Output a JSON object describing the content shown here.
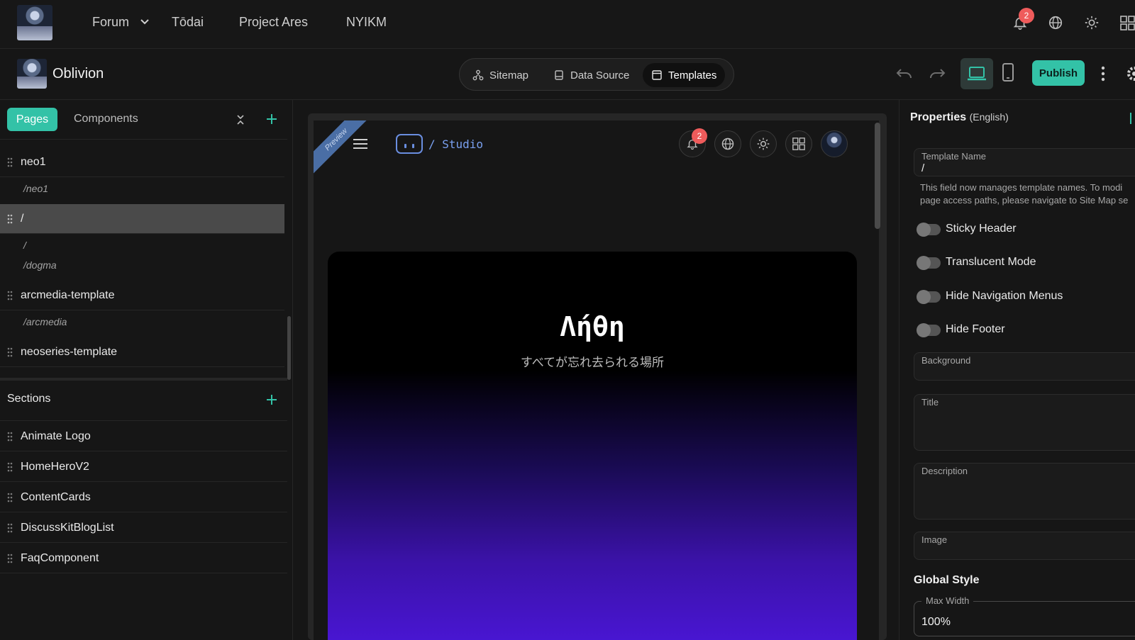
{
  "topnav": {
    "links": [
      "Forum",
      "Tōdai",
      "Project Ares",
      "NYIKM"
    ],
    "notification_count": "2"
  },
  "toolbar": {
    "site_name": "Oblivion",
    "tabs": [
      {
        "label": "Sitemap",
        "icon": "sitemap-icon"
      },
      {
        "label": "Data Source",
        "icon": "database-icon"
      },
      {
        "label": "Templates",
        "icon": "templates-icon",
        "active": true
      }
    ],
    "publish_label": "Publish"
  },
  "left": {
    "tabs": {
      "pages": "Pages",
      "components": "Components"
    },
    "pages": [
      {
        "name": "neo1",
        "paths": [
          "/neo1"
        ]
      },
      {
        "name": "/",
        "paths": [
          "/",
          "/dogma"
        ],
        "selected": true
      },
      {
        "name": "arcmedia-template",
        "paths": [
          "/arcmedia"
        ]
      },
      {
        "name": "neoseries-template",
        "paths": []
      }
    ],
    "sections_title": "Sections",
    "sections": [
      "Animate Logo",
      "HomeHeroV2",
      "ContentCards",
      "DiscussKitBlogList",
      "FaqComponent"
    ]
  },
  "preview": {
    "ribbon": "Preview",
    "brand": "/ Studio",
    "notification_count": "2",
    "hero_title": "Λήθη",
    "hero_subtitle": "すべてが忘れ去られる場所"
  },
  "properties": {
    "title": "Properties",
    "lang": "(English)",
    "template_name_label": "Template Name",
    "template_name_value": "/",
    "help_line1": "This field now manages template names. To modi",
    "help_line2": "page access paths, please navigate to Site Map se",
    "toggles": [
      "Sticky Header",
      "Translucent Mode",
      "Hide Navigation Menus",
      "Hide Footer"
    ],
    "background_label": "Background",
    "title_label": "Title",
    "description_label": "Description",
    "image_label": "Image",
    "global_style": "Global Style",
    "max_width_label": "Max Width",
    "max_width_value": "100%"
  },
  "colors": {
    "accent": "#33c2a7",
    "badge": "#ef5b5b",
    "hero_purple": "#4a16d6"
  }
}
